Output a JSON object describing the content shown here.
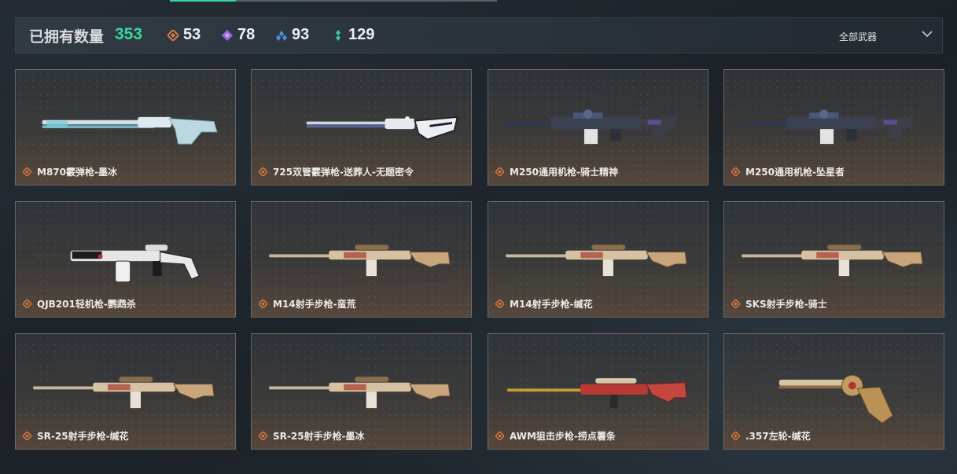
{
  "header": {
    "owned_label": "已拥有数量",
    "owned_count": "353",
    "stats": [
      {
        "icon": "orange-diamond-icon",
        "value": "53",
        "color": "#e07a3e"
      },
      {
        "icon": "purple-diamond-icon",
        "value": "78",
        "color": "#9b6ad8"
      },
      {
        "icon": "blue-diamond-icon",
        "value": "93",
        "color": "#4f8fd6"
      },
      {
        "icon": "green-diamond-icon",
        "value": "129",
        "color": "#3bc99a"
      }
    ],
    "filter_label": "全部武器"
  },
  "weapons": [
    {
      "name": "M870霰弹枪-墨冰",
      "icon": "shotgun"
    },
    {
      "name": "725双管霰弹枪-送葬人-无题密令",
      "icon": "double-barrel-shotgun"
    },
    {
      "name": "M250通用机枪-骑士精神",
      "icon": "machine-gun"
    },
    {
      "name": "M250通用机枪-坠星者",
      "icon": "machine-gun"
    },
    {
      "name": "QJB201轻机枪-鹦鹉杀",
      "icon": "light-machine-gun"
    },
    {
      "name": "M14射手步枪-蛮荒",
      "icon": "marksman-rifle"
    },
    {
      "name": "M14射手步枪-缄花",
      "icon": "marksman-rifle"
    },
    {
      "name": "SKS射手步枪-骑士",
      "icon": "marksman-rifle"
    },
    {
      "name": "SR-25射手步枪-缄花",
      "icon": "marksman-rifle"
    },
    {
      "name": "SR-25射手步枪-墨冰",
      "icon": "marksman-rifle"
    },
    {
      "name": "AWM狙击步枪-捞点薯条",
      "icon": "sniper-rifle"
    },
    {
      "name": ".357左轮-缄花",
      "icon": "revolver"
    }
  ],
  "colors": {
    "accent_green": "#35d69c",
    "rarity_orange": "#e07a3e"
  }
}
